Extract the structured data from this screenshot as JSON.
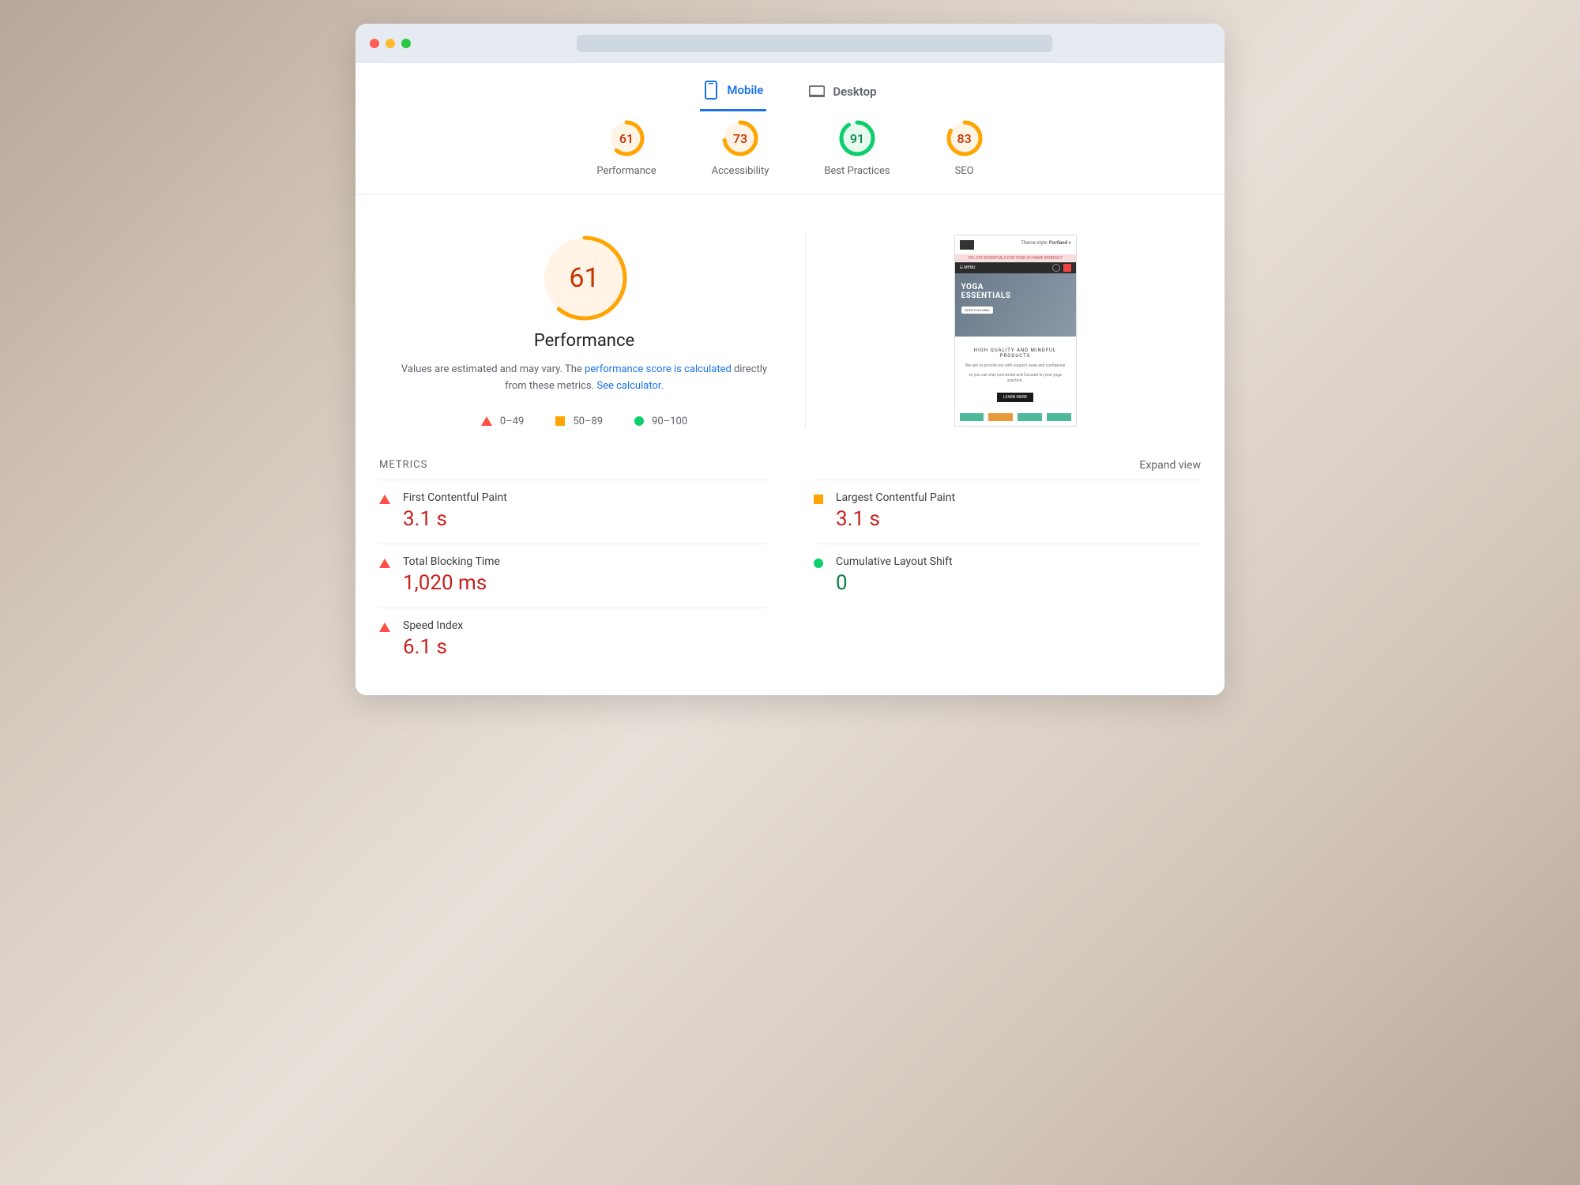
{
  "tabs": {
    "mobile": "Mobile",
    "desktop": "Desktop",
    "active": "mobile"
  },
  "scores": [
    {
      "label": "Performance",
      "value": 61,
      "color": "#ffa400",
      "bg": "#fff4e5",
      "text": "#c33300"
    },
    {
      "label": "Accessibility",
      "value": 73,
      "color": "#ffa400",
      "bg": "#fff4e5",
      "text": "#c33300"
    },
    {
      "label": "Best Practices",
      "value": 91,
      "color": "#0cce6b",
      "bg": "#e6faef",
      "text": "#0a8a46"
    },
    {
      "label": "SEO",
      "value": 83,
      "color": "#ffa400",
      "bg": "#fff4e5",
      "text": "#c33300"
    }
  ],
  "perf": {
    "score": 61,
    "title": "Performance",
    "desc_pre": "Values are estimated and may vary. The ",
    "link1": "performance score is calculated",
    "desc_mid": " directly from these metrics. ",
    "link2": "See calculator.",
    "legend": {
      "red": "0–49",
      "orange": "50–89",
      "green": "90–100"
    }
  },
  "preview": {
    "theme_label": "Theme style:",
    "theme_value": "Portland",
    "banner": "10% OFF ESSENTIALS FOR YOUR AT-HOME WORKOUT",
    "menu": "MENU",
    "hero_line1": "YOGA",
    "hero_line2": "ESSENTIALS",
    "hero_btn": "SHOP CLOTHING",
    "body_title": "HIGH QUALITY AND MINDFUL PRODUCTS",
    "body_p1": "We aim to provide you with support, ease and confidence",
    "body_p2": "so you can stay connected and focused on your yoga practice.",
    "cta": "LEARN MORE"
  },
  "metrics_header": {
    "title": "METRICS",
    "expand": "Expand view"
  },
  "metrics": [
    {
      "name": "First Contentful Paint",
      "value": "3.1 s",
      "ind": "tri-red",
      "cls": "val-red"
    },
    {
      "name": "Largest Contentful Paint",
      "value": "3.1 s",
      "ind": "sq-orange",
      "cls": "val-red"
    },
    {
      "name": "Total Blocking Time",
      "value": "1,020 ms",
      "ind": "tri-red",
      "cls": "val-red"
    },
    {
      "name": "Cumulative Layout Shift",
      "value": "0",
      "ind": "dot-green",
      "cls": "val-green"
    },
    {
      "name": "Speed Index",
      "value": "6.1 s",
      "ind": "tri-red",
      "cls": "val-red"
    }
  ],
  "chart_data": {
    "type": "gauge",
    "title": "Performance",
    "value": 61,
    "range": [
      0,
      100
    ],
    "thresholds": [
      {
        "label": "0–49",
        "color": "#ff4e42"
      },
      {
        "label": "50–89",
        "color": "#ffa400"
      },
      {
        "label": "90–100",
        "color": "#0cce6b"
      }
    ],
    "category_scores": [
      {
        "category": "Performance",
        "value": 61
      },
      {
        "category": "Accessibility",
        "value": 73
      },
      {
        "category": "Best Practices",
        "value": 91
      },
      {
        "category": "SEO",
        "value": 83
      }
    ]
  }
}
